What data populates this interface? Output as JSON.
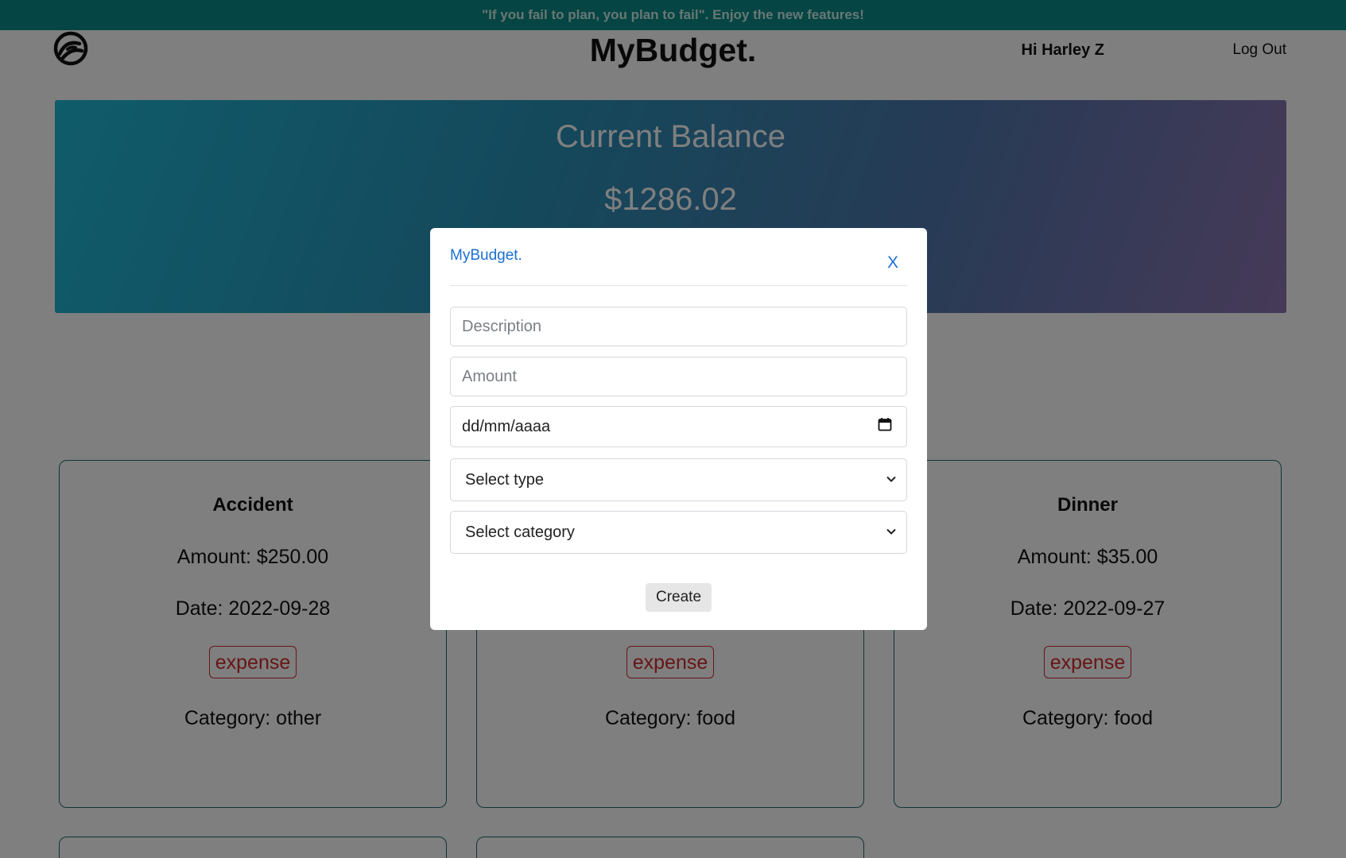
{
  "announcement": "\"If you fail to plan, you plan to fail\". Enjoy the new features!",
  "header": {
    "brand": "MyBudget.",
    "greeting": "Hi Harley Z",
    "logout": "Log Out"
  },
  "balance": {
    "title": "Current Balance",
    "value": "$1286.02"
  },
  "transactions": [
    {
      "title": "Accident",
      "amount": "Amount: $250.00",
      "date": "Date: 2022-09-28",
      "type": "expense",
      "category": "Category: other"
    },
    {
      "title": "",
      "amount": "",
      "date": "",
      "type": "expense",
      "category": "Category: food"
    },
    {
      "title": "Dinner",
      "amount": "Amount: $35.00",
      "date": "Date: 2022-09-27",
      "type": "expense",
      "category": "Category: food"
    }
  ],
  "modal": {
    "brand": "MyBudget.",
    "close": "X",
    "description_placeholder": "Description",
    "amount_placeholder": "Amount",
    "date_value": "dd/mm/aaaa",
    "type_selected": "Select type",
    "category_selected": "Select category",
    "create": "Create"
  },
  "colors": {
    "announcement_bg": "#0a8a87",
    "accent_link": "#1a6fd1",
    "expense": "#d12a2a",
    "card_border": "#1b6b6b"
  }
}
